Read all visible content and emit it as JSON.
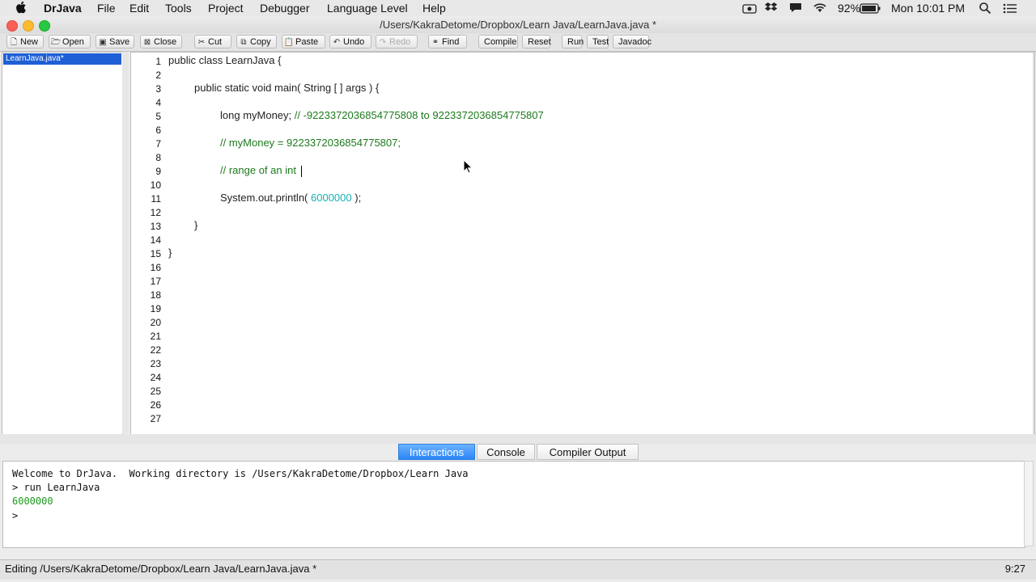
{
  "menubar": {
    "app_name": "DrJava",
    "items": [
      "File",
      "Edit",
      "Tools",
      "Project",
      "Debugger",
      "Language Level",
      "Help"
    ],
    "battery": "92%",
    "clock": "Mon 10:01 PM"
  },
  "window": {
    "title": "/Users/KakraDetome/Dropbox/Learn Java/LearnJava.java *"
  },
  "toolbar": {
    "new": "New",
    "open": "Open",
    "save": "Save",
    "close": "Close",
    "cut": "Cut",
    "copy": "Copy",
    "paste": "Paste",
    "undo": "Undo",
    "redo": "Redo",
    "find": "Find",
    "compile": "Compile",
    "reset": "Reset",
    "run": "Run",
    "test": "Test",
    "javadoc": "Javadoc"
  },
  "sidebar": {
    "files": [
      "LearnJava.java*"
    ]
  },
  "editor": {
    "line_numbers": [
      "1",
      "2",
      "3",
      "4",
      "5",
      "6",
      "7",
      "8",
      "9",
      "10",
      "11",
      "12",
      "13",
      "14",
      "15",
      "16",
      "17",
      "18",
      "19",
      "20",
      "21",
      "22",
      "23",
      "24",
      "25",
      "26",
      "27"
    ],
    "line1": "public class LearnJava {",
    "line3": "public static void main( String [ ] args ) {",
    "line5_code": "long myMoney; ",
    "line5_comment": "// -9223372036854775808 to 9223372036854775807",
    "line7_comment": "// myMoney = 9223372036854775807;",
    "line9_comment": "// range of an int ",
    "line11_pre": "System.out.println( ",
    "line11_num": "6000000",
    "line11_post": " );",
    "line13": "}",
    "line15": "}"
  },
  "tabs": {
    "interactions": "Interactions",
    "console": "Console",
    "compiler_output": "Compiler Output",
    "active": "Interactions"
  },
  "interactions": {
    "line1": "Welcome to DrJava.  Working directory is /Users/KakraDetome/Dropbox/Learn Java",
    "line2": "> run LearnJava",
    "line3": "6000000",
    "line4": ">"
  },
  "status": {
    "text": "Editing /Users/KakraDetome/Dropbox/Learn Java/LearnJava.java *",
    "position": "9:27"
  },
  "colors": {
    "selection": "#1f5fd6",
    "comment": "#1d7a1d",
    "number": "#17b2b2",
    "active_tab": "#2a86f5"
  }
}
